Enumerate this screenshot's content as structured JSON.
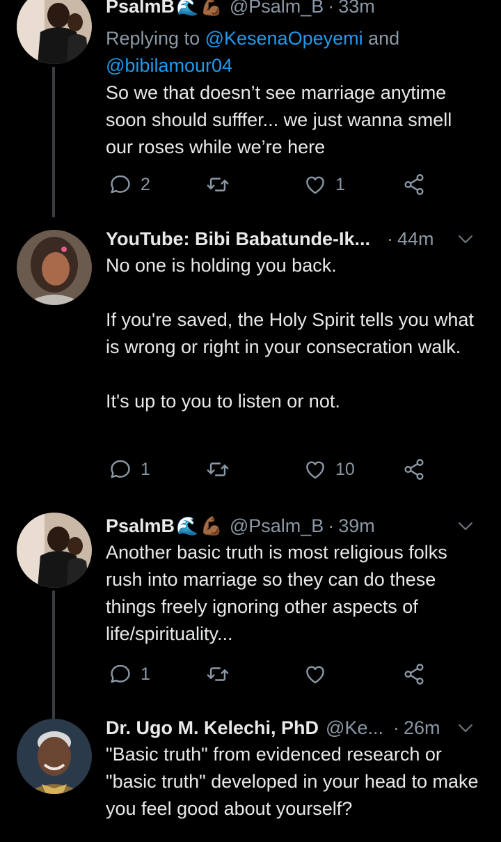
{
  "tweets": [
    {
      "name": "PsalmB",
      "handle": "@Psalm_B",
      "time": "33m",
      "replying_prefix": "Replying to ",
      "replying_user1": "@KesenaOpeyemi",
      "replying_and": " and",
      "replying_user2": "@bibilamour04",
      "text": "So we that doesn’t see marriage anytime soon should sufffer... we just wanna smell our roses while we’re here",
      "replies": "2",
      "retweets": "",
      "likes": "1"
    },
    {
      "name": "YouTube: Bibi Babatunde-Ik...",
      "handle": "",
      "time": "44m",
      "text": "No one is holding you back.\n\nIf you're saved, the Holy Spirit tells you what is wrong or right in your consecration walk.\n\nIt's up to you to listen or not.",
      "replies": "1",
      "retweets": "",
      "likes": "10"
    },
    {
      "name": "PsalmB",
      "handle": "@Psalm_B",
      "time": "39m",
      "text": "Another basic truth is most religious folks rush into marriage so they can do these things freely ignoring other aspects of life/spirituality...",
      "replies": "1",
      "retweets": "",
      "likes": ""
    },
    {
      "name": "Dr. Ugo M. Kelechi, PhD",
      "handle": "@Ke...",
      "time": "26m",
      "text": "\"Basic truth\" from evidenced research or \"basic truth\" developed in your head to make you feel good about yourself?"
    }
  ],
  "separator": "·",
  "colors": {
    "background": "#000000",
    "text": "#e7e9ea",
    "secondary": "#8b98a5",
    "link": "#1d9bf0",
    "thread_line": "#3a3d40"
  },
  "icons": [
    "reply-icon",
    "retweet-icon",
    "like-icon",
    "share-icon",
    "chevron-down-icon",
    "wave-emoji",
    "flexed-biceps-emoji"
  ]
}
